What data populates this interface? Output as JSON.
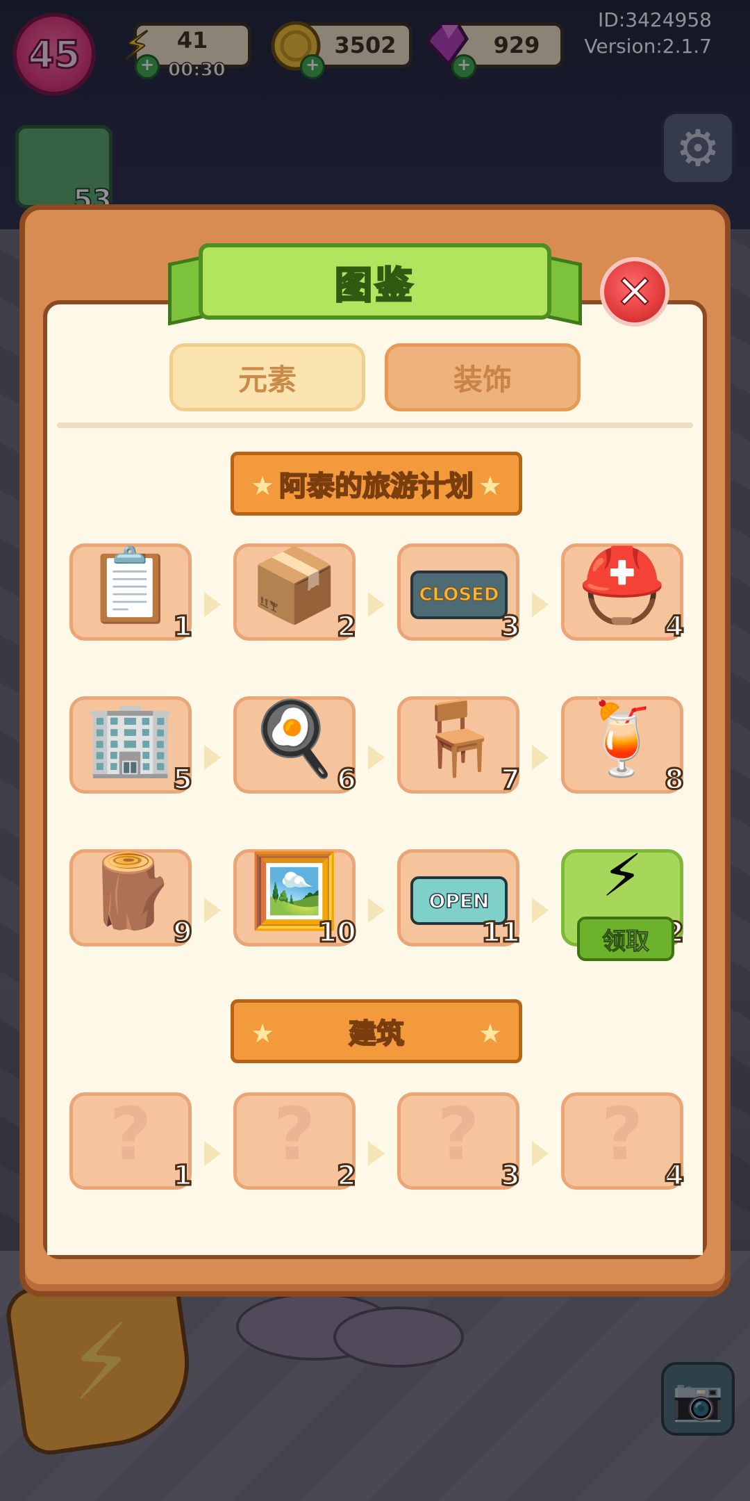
{
  "hud": {
    "level": "45",
    "energy": "41",
    "energy_timer": "00:30",
    "coins": "3502",
    "gems": "929",
    "id": "ID:3424958",
    "version": "Version:2.1.7"
  },
  "side_quest_count": "53",
  "icons": {
    "energy": "lightning-bolt-icon",
    "coin": "coin-icon",
    "gem": "gem-icon",
    "settings": "gear-icon",
    "camera": "camera-icon",
    "close": "close-icon"
  },
  "modal": {
    "title": "图鉴",
    "close_glyph": "✕",
    "tabs": [
      {
        "label": "元素"
      },
      {
        "label": "装饰"
      }
    ],
    "sections": [
      {
        "title": "阿泰的旅游计划",
        "items": [
          {
            "number": "1",
            "icon": "📋"
          },
          {
            "number": "2",
            "icon": "📦"
          },
          {
            "number": "3",
            "icon": "🪧",
            "sign_text": "CLOSED"
          },
          {
            "number": "4",
            "icon": "⛑️"
          },
          {
            "number": "5",
            "icon": "🏢"
          },
          {
            "number": "6",
            "icon": "🍳"
          },
          {
            "number": "7",
            "icon": "🪑"
          },
          {
            "number": "8",
            "icon": "🍹"
          },
          {
            "number": "9",
            "icon": "🪵"
          },
          {
            "number": "10",
            "icon": "🖼️"
          },
          {
            "number": "11",
            "icon": "🪧",
            "sign_text": "OPEN"
          },
          {
            "number": "12",
            "icon": "⚡",
            "claim_label": "领取"
          }
        ]
      },
      {
        "title": "建筑",
        "items": [
          {
            "number": "1",
            "icon": "?"
          },
          {
            "number": "2",
            "icon": "?"
          },
          {
            "number": "3",
            "icon": "?"
          },
          {
            "number": "4",
            "icon": "?"
          }
        ]
      }
    ]
  },
  "colors": {
    "panel_border": "#8b4a22",
    "panel_bg": "#d98c52",
    "inner_bg": "#fdf8e7",
    "title_green": "#b3e45e",
    "section_orange": "#f39a3c",
    "card_bg": "#f5c39c",
    "claim_green": "#6cb22a"
  }
}
